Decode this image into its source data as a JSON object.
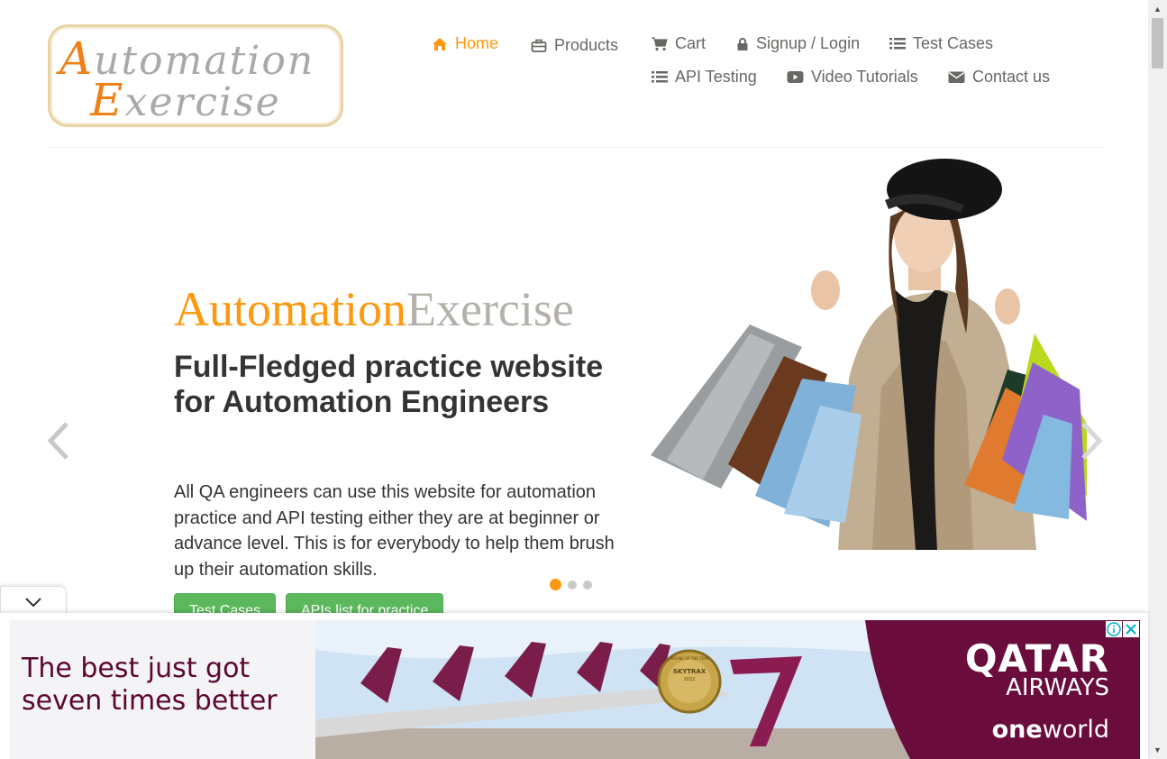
{
  "logo": {
    "line1_cap": "A",
    "line1_rest": "utomation",
    "line2_cap": "E",
    "line2_rest": "xercise"
  },
  "nav": {
    "home": "Home",
    "products": "Products",
    "cart": "Cart",
    "signup": "Signup / Login",
    "test_cases": "Test Cases",
    "api_testing": "API Testing",
    "video_tutorials": "Video Tutorials",
    "contact": "Contact us"
  },
  "slider": {
    "brand_a": "Automation",
    "brand_b": "Exercise",
    "headline": "Full-Fledged practice website for Automation Engineers",
    "description": "All QA engineers can use this website for automation practice and API testing either they are at beginner or advance level. This is for everybody to help them brush up their automation skills.",
    "btn_test_cases": "Test Cases",
    "btn_apis": "APIs list for practice",
    "active_slide": 1,
    "slide_count": 3
  },
  "ad": {
    "line1": "The best just got",
    "line2": "seven times better",
    "brand_top": "QATAR",
    "brand_bottom": "AIRWAYS",
    "alliance_bold": "one",
    "alliance_rest": "world",
    "badge_top": "AIRLINE OF THE YEAR",
    "badge_mid": "SKYTRAX",
    "badge_bottom": "2022"
  },
  "colors": {
    "accent": "#fe980f",
    "text": "#696763",
    "dark": "#363432",
    "button": "#5cb85c",
    "ad_brand": "#5c0632"
  },
  "icons": [
    "home-icon",
    "briefcase-icon",
    "cart-icon",
    "lock-icon",
    "list-icon",
    "list-icon",
    "video-icon",
    "envelope-icon",
    "chevron-left-icon",
    "chevron-right-icon",
    "chevron-down-icon",
    "info-icon",
    "close-icon"
  ]
}
